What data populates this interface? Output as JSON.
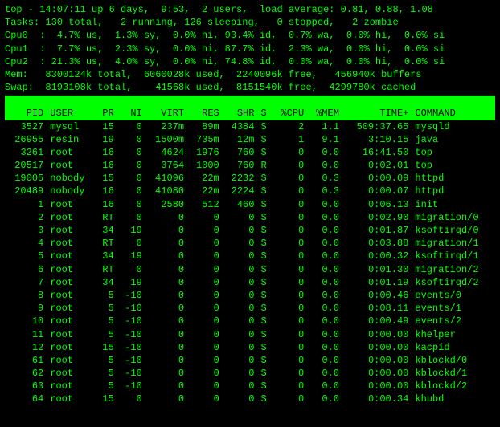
{
  "header": {
    "line1": "top - 14:07:11 up 6 days,  9:53,  2 users,  load average: 0.81, 0.88, 1.08",
    "line2": "Tasks: 130 total,   2 running, 126 sleeping,   0 stopped,   2 zombie",
    "line3": "Cpu0  :  4.7% us,  1.3% sy,  0.0% ni, 93.4% id,  0.7% wa,  0.0% hi,  0.0% si",
    "line4": "Cpu1  :  7.7% us,  2.3% sy,  0.0% ni, 87.7% id,  2.3% wa,  0.0% hi,  0.0% si",
    "line5": "Cpu2  : 21.3% us,  4.0% sy,  0.0% ni, 74.8% id,  0.0% wa,  0.0% hi,  0.0% si",
    "line6": "Mem:   8300124k total,  6060028k used,  2240096k free,   456940k buffers",
    "line7": "Swap:  8193108k total,    41568k used,  8151540k free,  4299780k cached"
  },
  "columns": [
    "PID",
    "USER",
    "PR",
    "NI",
    "VIRT",
    "RES",
    "SHR",
    "S",
    "%CPU",
    "%MEM",
    "TIME+",
    "COMMAND"
  ],
  "rows": [
    {
      "pid": "3527",
      "user": "mysql",
      "pr": "15",
      "ni": "0",
      "virt": "237m",
      "res": "89m",
      "shr": "4384",
      "s": "S",
      "cpu": "2",
      "mem": "1.1",
      "time": "509:37.65",
      "cmd": "mysqld"
    },
    {
      "pid": "26955",
      "user": "resin",
      "pr": "19",
      "ni": "0",
      "virt": "1500m",
      "res": "735m",
      "shr": "12m",
      "s": "S",
      "cpu": "1",
      "mem": "9.1",
      "time": "3:10.15",
      "cmd": "java"
    },
    {
      "pid": "3261",
      "user": "root",
      "pr": "16",
      "ni": "0",
      "virt": "4624",
      "res": "1976",
      "shr": "760",
      "s": "S",
      "cpu": "0",
      "mem": "0.0",
      "time": "16:41.50",
      "cmd": "top"
    },
    {
      "pid": "20517",
      "user": "root",
      "pr": "16",
      "ni": "0",
      "virt": "3764",
      "res": "1000",
      "shr": "760",
      "s": "R",
      "cpu": "0",
      "mem": "0.0",
      "time": "0:02.01",
      "cmd": "top"
    },
    {
      "pid": "19005",
      "user": "nobody",
      "pr": "15",
      "ni": "0",
      "virt": "41096",
      "res": "22m",
      "shr": "2232",
      "s": "S",
      "cpu": "0",
      "mem": "0.3",
      "time": "0:00.09",
      "cmd": "httpd"
    },
    {
      "pid": "20489",
      "user": "nobody",
      "pr": "16",
      "ni": "0",
      "virt": "41080",
      "res": "22m",
      "shr": "2224",
      "s": "S",
      "cpu": "0",
      "mem": "0.3",
      "time": "0:00.07",
      "cmd": "httpd"
    },
    {
      "pid": "1",
      "user": "root",
      "pr": "16",
      "ni": "0",
      "virt": "2580",
      "res": "512",
      "shr": "460",
      "s": "S",
      "cpu": "0",
      "mem": "0.0",
      "time": "0:06.13",
      "cmd": "init"
    },
    {
      "pid": "2",
      "user": "root",
      "pr": "RT",
      "ni": "0",
      "virt": "0",
      "res": "0",
      "shr": "0",
      "s": "S",
      "cpu": "0",
      "mem": "0.0",
      "time": "0:02.90",
      "cmd": "migration/0"
    },
    {
      "pid": "3",
      "user": "root",
      "pr": "34",
      "ni": "19",
      "virt": "0",
      "res": "0",
      "shr": "0",
      "s": "S",
      "cpu": "0",
      "mem": "0.0",
      "time": "0:01.87",
      "cmd": "ksoftirqd/0"
    },
    {
      "pid": "4",
      "user": "root",
      "pr": "RT",
      "ni": "0",
      "virt": "0",
      "res": "0",
      "shr": "0",
      "s": "S",
      "cpu": "0",
      "mem": "0.0",
      "time": "0:03.88",
      "cmd": "migration/1"
    },
    {
      "pid": "5",
      "user": "root",
      "pr": "34",
      "ni": "19",
      "virt": "0",
      "res": "0",
      "shr": "0",
      "s": "S",
      "cpu": "0",
      "mem": "0.0",
      "time": "0:00.32",
      "cmd": "ksoftirqd/1"
    },
    {
      "pid": "6",
      "user": "root",
      "pr": "RT",
      "ni": "0",
      "virt": "0",
      "res": "0",
      "shr": "0",
      "s": "S",
      "cpu": "0",
      "mem": "0.0",
      "time": "0:01.30",
      "cmd": "migration/2"
    },
    {
      "pid": "7",
      "user": "root",
      "pr": "34",
      "ni": "19",
      "virt": "0",
      "res": "0",
      "shr": "0",
      "s": "S",
      "cpu": "0",
      "mem": "0.0",
      "time": "0:01.19",
      "cmd": "ksoftirqd/2"
    },
    {
      "pid": "8",
      "user": "root",
      "pr": "5",
      "ni": "-10",
      "virt": "0",
      "res": "0",
      "shr": "0",
      "s": "S",
      "cpu": "0",
      "mem": "0.0",
      "time": "0:00.46",
      "cmd": "events/0"
    },
    {
      "pid": "9",
      "user": "root",
      "pr": "5",
      "ni": "-10",
      "virt": "0",
      "res": "0",
      "shr": "0",
      "s": "S",
      "cpu": "0",
      "mem": "0.0",
      "time": "0:08.11",
      "cmd": "events/1"
    },
    {
      "pid": "10",
      "user": "root",
      "pr": "5",
      "ni": "-10",
      "virt": "0",
      "res": "0",
      "shr": "0",
      "s": "S",
      "cpu": "0",
      "mem": "0.0",
      "time": "0:00.49",
      "cmd": "events/2"
    },
    {
      "pid": "11",
      "user": "root",
      "pr": "5",
      "ni": "-10",
      "virt": "0",
      "res": "0",
      "shr": "0",
      "s": "S",
      "cpu": "0",
      "mem": "0.0",
      "time": "0:00.00",
      "cmd": "khelper"
    },
    {
      "pid": "12",
      "user": "root",
      "pr": "15",
      "ni": "-10",
      "virt": "0",
      "res": "0",
      "shr": "0",
      "s": "S",
      "cpu": "0",
      "mem": "0.0",
      "time": "0:00.00",
      "cmd": "kacpid"
    },
    {
      "pid": "61",
      "user": "root",
      "pr": "5",
      "ni": "-10",
      "virt": "0",
      "res": "0",
      "shr": "0",
      "s": "S",
      "cpu": "0",
      "mem": "0.0",
      "time": "0:00.00",
      "cmd": "kblockd/0"
    },
    {
      "pid": "62",
      "user": "root",
      "pr": "5",
      "ni": "-10",
      "virt": "0",
      "res": "0",
      "shr": "0",
      "s": "S",
      "cpu": "0",
      "mem": "0.0",
      "time": "0:00.00",
      "cmd": "kblockd/1"
    },
    {
      "pid": "63",
      "user": "root",
      "pr": "5",
      "ni": "-10",
      "virt": "0",
      "res": "0",
      "shr": "0",
      "s": "S",
      "cpu": "0",
      "mem": "0.0",
      "time": "0:00.00",
      "cmd": "kblockd/2"
    },
    {
      "pid": "64",
      "user": "root",
      "pr": "15",
      "ni": "0",
      "virt": "0",
      "res": "0",
      "shr": "0",
      "s": "S",
      "cpu": "0",
      "mem": "0.0",
      "time": "0:00.34",
      "cmd": "khubd"
    }
  ]
}
